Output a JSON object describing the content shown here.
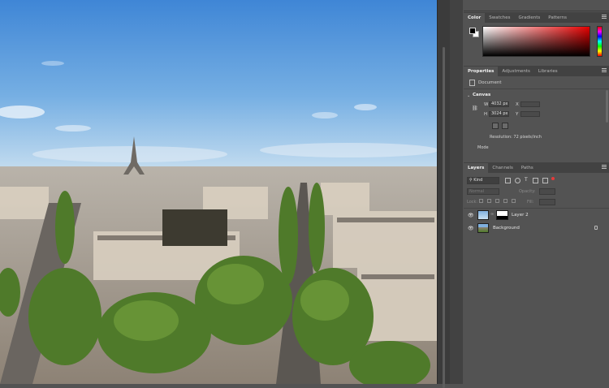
{
  "color_panel": {
    "tabs": [
      "Color",
      "Swatches",
      "Gradients",
      "Patterns"
    ],
    "active_tab": "Color",
    "foreground": "#000000",
    "background": "#ffffff",
    "hue_color": "#e60000"
  },
  "properties_panel": {
    "tabs": [
      "Properties",
      "Adjustments",
      "Libraries"
    ],
    "active_tab": "Properties",
    "document_label": "Document",
    "canvas_section": "Canvas",
    "w_label": "W",
    "w_value": "4032 px",
    "x_label": "X",
    "h_label": "H",
    "h_value": "3024 px",
    "y_label": "Y",
    "resolution": "Resolution: 72 pixels/inch",
    "mode_label": "Mode"
  },
  "layers_panel": {
    "tabs": [
      "Layers",
      "Channels",
      "Paths"
    ],
    "active_tab": "Layers",
    "filter_kind": "Kind",
    "blend_mode": "Normal",
    "opacity_label": "Opacity:",
    "lock_label": "Lock:",
    "fill_label": "Fill:",
    "layers": [
      {
        "name": "Layer 2",
        "visible": true
      },
      {
        "name": "Background",
        "visible": true,
        "locked": true
      }
    ]
  }
}
